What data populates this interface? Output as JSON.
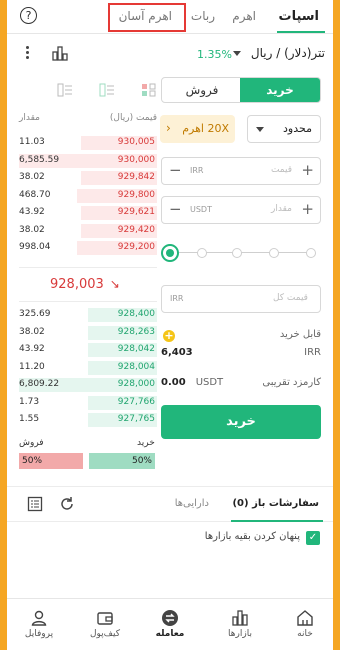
{
  "top_tabs": [
    {
      "label": "اسپات",
      "active": true
    },
    {
      "label": "اهرم"
    },
    {
      "label": "ربات"
    },
    {
      "label": "اهرم آسان"
    }
  ],
  "help_icon": "?",
  "pair": {
    "name": "تتر(دلار) / ریال",
    "change": "1.35%"
  },
  "trade": {
    "buy_tab": "خرید",
    "sell_tab": "فروش",
    "order_type": "محدود",
    "leverage": "20X اهرم",
    "price_placeholder": "قیمت",
    "price_unit": "IRR",
    "amount_placeholder": "مقدار",
    "amount_unit": "USDT",
    "total_placeholder": "قیمت کل",
    "total_unit": "IRR",
    "slider_percent": 0,
    "available_label": "قابل خرید",
    "available_value": "6,403",
    "available_unit": "IRR",
    "fee_label": "کارمزد تقریبی",
    "fee_value": "0.00",
    "fee_unit": "USDT",
    "submit": "خرید"
  },
  "orderbook": {
    "price_header": "قیمت (ریال)",
    "amount_header": "مقدار",
    "asks": [
      {
        "price": "930,005",
        "amount": "11.03",
        "depth": 0.55
      },
      {
        "price": "930,000",
        "amount": "6,585.59",
        "depth": 1.0
      },
      {
        "price": "929,842",
        "amount": "38.02",
        "depth": 0.55
      },
      {
        "price": "929,800",
        "amount": "468.70",
        "depth": 0.58
      },
      {
        "price": "929,621",
        "amount": "43.92",
        "depth": 0.55
      },
      {
        "price": "929,420",
        "amount": "38.02",
        "depth": 0.55
      },
      {
        "price": "929,200",
        "amount": "998.04",
        "depth": 0.58
      }
    ],
    "last_price": "928,003",
    "bids": [
      {
        "price": "928,400",
        "amount": "325.69",
        "depth": 0.5
      },
      {
        "price": "928,263",
        "amount": "38.02",
        "depth": 0.5
      },
      {
        "price": "928,042",
        "amount": "43.92",
        "depth": 0.5
      },
      {
        "price": "928,004",
        "amount": "11.20",
        "depth": 0.5
      },
      {
        "price": "928,000",
        "amount": "6,809.22",
        "depth": 1.0
      },
      {
        "price": "927,766",
        "amount": "1.73",
        "depth": 0.5
      },
      {
        "price": "927,765",
        "amount": "1.55",
        "depth": 0.5
      }
    ],
    "buy_label": "خرید",
    "sell_label": "فروش",
    "buy_ratio": "50%",
    "sell_ratio": "50%"
  },
  "orders": {
    "open_tab": "سفارشات باز (0)",
    "assets_tab": "دارایی‌ها",
    "hide_others": "پنهان کردن بقیه بازارها",
    "hide_others_checked": true
  },
  "bottom_nav": [
    {
      "label": "خانه",
      "icon": "home-icon"
    },
    {
      "label": "بازارها",
      "icon": "markets-icon"
    },
    {
      "label": "معامله",
      "icon": "trade-icon",
      "active": true
    },
    {
      "label": "کیف‌پول",
      "icon": "wallet-icon"
    },
    {
      "label": "پروفایل",
      "icon": "profile-icon"
    }
  ],
  "colors": {
    "accent": "#21b67b",
    "sell": "#d83a3a",
    "frame": "#f5a623",
    "highlight_box": "#e53935"
  }
}
